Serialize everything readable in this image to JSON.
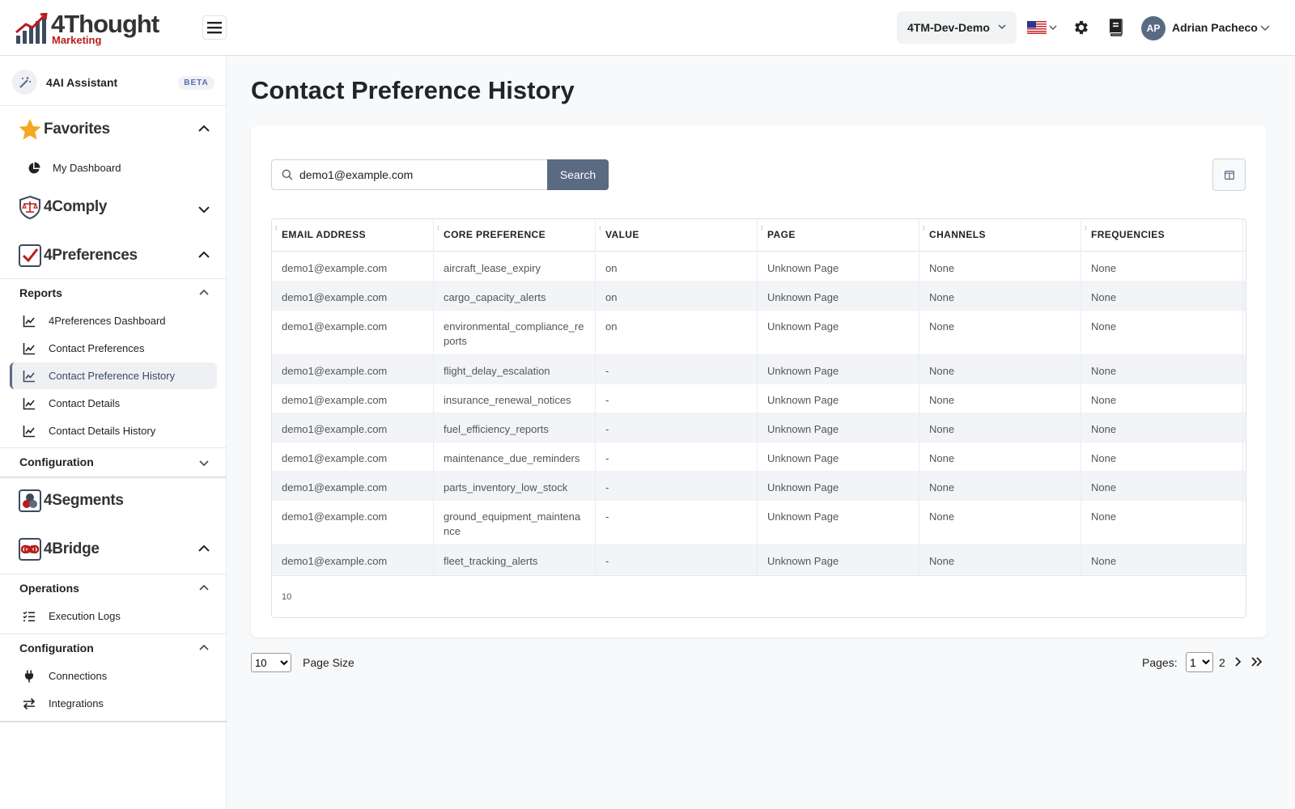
{
  "header": {
    "brand": "4Thought",
    "brand_sub": "Marketing",
    "org": "4TM-Dev-Demo",
    "user_initials": "AP",
    "user_name": "Adrian Pacheco"
  },
  "sidebar": {
    "ai_label": "4AI Assistant",
    "beta": "BETA",
    "favorites": "Favorites",
    "my_dashboard": "My Dashboard",
    "comply": "4Comply",
    "preferences": "4Preferences",
    "reports": "Reports",
    "report_items": [
      "4Preferences Dashboard",
      "Contact Preferences",
      "Contact Preference History",
      "Contact Details",
      "Contact Details History"
    ],
    "configuration": "Configuration",
    "segments": "4Segments",
    "bridge": "4Bridge",
    "operations": "Operations",
    "execution_logs": "Execution Logs",
    "configuration2": "Configuration",
    "connections": "Connections",
    "integrations": "Integrations"
  },
  "main": {
    "title": "Contact Preference History",
    "search_value": "demo1@example.com",
    "search_button": "Search",
    "columns": [
      "EMAIL ADDRESS",
      "CORE PREFERENCE",
      "VALUE",
      "PAGE",
      "CHANNELS",
      "FREQUENCIES"
    ],
    "rows": [
      [
        "demo1@example.com",
        "aircraft_lease_expiry",
        "on",
        "Unknown Page",
        "None",
        "None"
      ],
      [
        "demo1@example.com",
        "cargo_capacity_alerts",
        "on",
        "Unknown Page",
        "None",
        "None"
      ],
      [
        "demo1@example.com",
        "environmental_compliance_reports",
        "on",
        "Unknown Page",
        "None",
        "None"
      ],
      [
        "demo1@example.com",
        "flight_delay_escalation",
        "-",
        "Unknown Page",
        "None",
        "None"
      ],
      [
        "demo1@example.com",
        "insurance_renewal_notices",
        "-",
        "Unknown Page",
        "None",
        "None"
      ],
      [
        "demo1@example.com",
        "fuel_efficiency_reports",
        "-",
        "Unknown Page",
        "None",
        "None"
      ],
      [
        "demo1@example.com",
        "maintenance_due_reminders",
        "-",
        "Unknown Page",
        "None",
        "None"
      ],
      [
        "demo1@example.com",
        "parts_inventory_low_stock",
        "-",
        "Unknown Page",
        "None",
        "None"
      ],
      [
        "demo1@example.com",
        "ground_equipment_maintenance",
        "-",
        "Unknown Page",
        "None",
        "None"
      ],
      [
        "demo1@example.com",
        "fleet_tracking_alerts",
        "-",
        "Unknown Page",
        "None",
        "None"
      ]
    ],
    "row_count": "10"
  },
  "pagination": {
    "page_size": "10",
    "page_size_label": "Page Size",
    "pages_label": "Pages:",
    "current_page": "1",
    "next_page": "2"
  },
  "colors": {
    "accent": "#5a6a82",
    "brand_red": "#b91c1c",
    "favorites_star": "#f5a623"
  }
}
